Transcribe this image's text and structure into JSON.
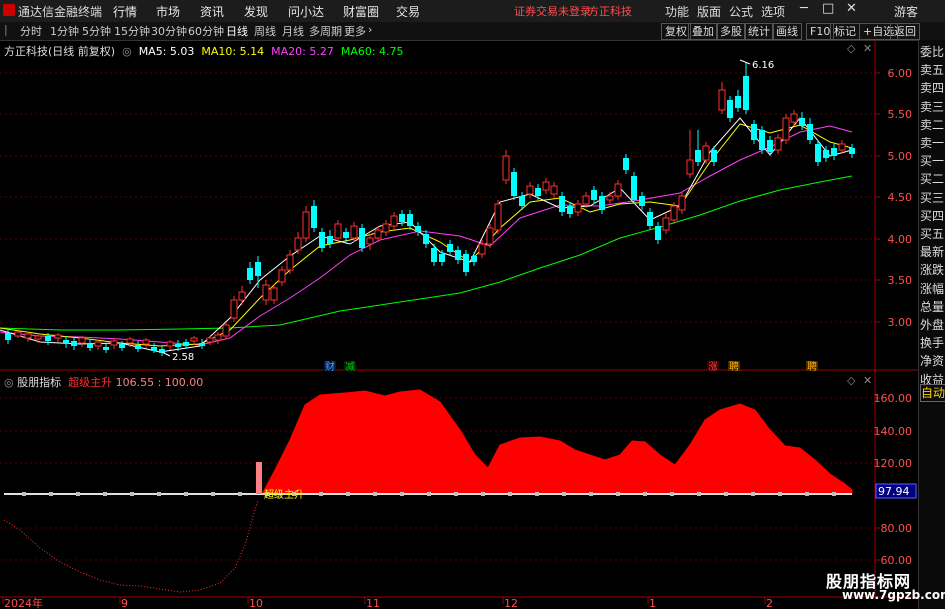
{
  "window": {
    "app_name": "通达信金融终端",
    "menu": [
      "行情",
      "市场",
      "资讯",
      "发现",
      "问小达",
      "财富圈",
      "交易"
    ],
    "login_status": "证券交易未登录",
    "broker": "方正科技",
    "right_buttons": [
      "功能",
      "版面",
      "公式",
      "选项"
    ],
    "guest": "游客"
  },
  "toolbar": {
    "periods": [
      "分时",
      "1分钟",
      "5分钟",
      "15分钟",
      "30分钟",
      "60分钟",
      "日线",
      "周线",
      "月线",
      "多周期",
      "更多"
    ],
    "active_period": "日线",
    "right": [
      "复权",
      "叠加",
      "多股",
      "统计",
      "画线",
      "F10",
      "标记",
      "+自选",
      "返回"
    ]
  },
  "stock": {
    "title": "方正科技(日线 前复权)",
    "ma": [
      {
        "label": "MA5: 5.03",
        "color": "#ffffff"
      },
      {
        "label": "MA10: 5.14",
        "color": "#ffff00"
      },
      {
        "label": "MA20: 5.27",
        "color": "#ff40ff"
      },
      {
        "label": "MA60: 4.75",
        "color": "#00ff00"
      }
    ],
    "high_label": "6.16",
    "low_label": "2.58",
    "price_axis": [
      "6.00",
      "5.50",
      "5.00",
      "4.50",
      "4.00",
      "3.50",
      "3.00"
    ],
    "events": [
      {
        "label": "财",
        "color": "#4aa0ff"
      },
      {
        "label": "减",
        "color": "#00cc00"
      },
      {
        "label": "涨",
        "color": "#ff4040"
      },
      {
        "label": "聘",
        "color": "#ffaa00"
      },
      {
        "label": "聘",
        "color": "#ffaa00"
      }
    ]
  },
  "indicator": {
    "name": "股朋指标",
    "series_label": "超级主升",
    "values": "106.55 : 100.00",
    "signal_text": "超级主升",
    "axis": [
      "160.00",
      "140.00",
      "120.00",
      "80.00",
      "60.00"
    ],
    "current": "97.94"
  },
  "date_axis": [
    "2024年",
    "9",
    "10",
    "11",
    "12",
    "1",
    "2"
  ],
  "sidebar": [
    "委比",
    "卖五",
    "卖四",
    "卖三",
    "卖二",
    "卖一",
    "买一",
    "买二",
    "买三",
    "买四",
    "买五",
    "最新",
    "涨跌",
    "涨幅",
    "总量",
    "外盘",
    "换手",
    "净资",
    "收益",
    "自动"
  ],
  "watermark": {
    "line1": "股朋指标网",
    "line2": "www.7gpzb.com"
  },
  "colors": {
    "up": "#ff3030",
    "down": "#00ffff",
    "ma5": "#ffffff",
    "ma10": "#ffff00",
    "ma20": "#ff40ff",
    "ma60": "#00ff00",
    "area": "#ff0000"
  }
}
